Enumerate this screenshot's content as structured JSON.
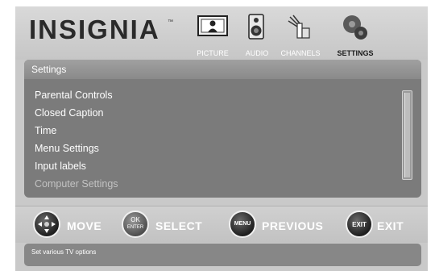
{
  "brand": {
    "name": "INSIGNIA",
    "trademark": "™"
  },
  "tabs": [
    {
      "label": "PICTURE",
      "icon": "picture-icon",
      "active": false
    },
    {
      "label": "AUDIO",
      "icon": "audio-icon",
      "active": false
    },
    {
      "label": "CHANNELS",
      "icon": "channels-icon",
      "active": false
    },
    {
      "label": "SETTINGS",
      "icon": "settings-icon",
      "active": true
    }
  ],
  "panel": {
    "title": "Settings",
    "items": [
      {
        "label": "Parental Controls",
        "enabled": true
      },
      {
        "label": "Closed Caption",
        "enabled": true
      },
      {
        "label": "Time",
        "enabled": true
      },
      {
        "label": "Menu Settings",
        "enabled": true
      },
      {
        "label": "Input labels",
        "enabled": true
      },
      {
        "label": "Computer Settings",
        "enabled": false
      }
    ]
  },
  "nav": {
    "move": {
      "label": "MOVE",
      "icon": "dpad-icon"
    },
    "select": {
      "label": "SELECT",
      "icon_text_top": "OK",
      "icon_text_bottom": "ENTER"
    },
    "previous": {
      "label": "PREVIOUS",
      "icon_text": "MENU"
    },
    "exit": {
      "label": "EXIT",
      "icon_text": "EXIT"
    }
  },
  "status": {
    "text": "Set various TV options"
  }
}
